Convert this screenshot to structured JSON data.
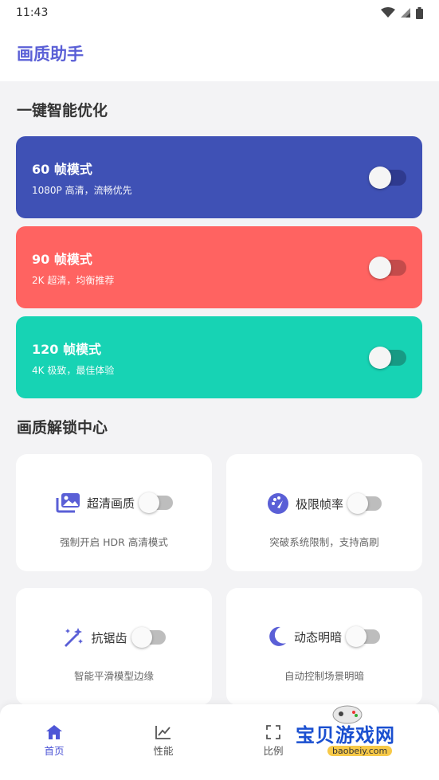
{
  "status": {
    "time": "11:43"
  },
  "header": {
    "title": "画质助手"
  },
  "sections": {
    "one_click": "一键智能优化",
    "unlock_center": "画质解锁中心"
  },
  "modes": [
    {
      "title": "60 帧模式",
      "subtitle": "1080P 高清，流畅优先",
      "color": "#3f51b5"
    },
    {
      "title": "90 帧模式",
      "subtitle": "2K 超清，均衡推荐",
      "color": "#ff6361"
    },
    {
      "title": "120 帧模式",
      "subtitle": "4K 极致，最佳体验",
      "color": "#17d3b4"
    }
  ],
  "features": [
    {
      "label": "超清画质",
      "desc": "强制开启 HDR 高清模式",
      "icon": "images-icon"
    },
    {
      "label": "极限帧率",
      "desc": "突破系统限制，支持高刷",
      "icon": "gauge-icon"
    },
    {
      "label": "抗锯齿",
      "desc": "智能平滑模型边缘",
      "icon": "magic-wand-icon"
    },
    {
      "label": "动态明暗",
      "desc": "自动控制场景明暗",
      "icon": "moon-icon"
    }
  ],
  "nav": [
    {
      "label": "首页",
      "icon": "home-icon",
      "active": true
    },
    {
      "label": "性能",
      "icon": "chart-icon",
      "active": false
    },
    {
      "label": "比例",
      "icon": "fullscreen-icon",
      "active": false
    },
    {
      "label": "",
      "icon": "more-icon",
      "active": false
    }
  ],
  "watermark": {
    "main": "宝贝游戏网",
    "sub": "baobeiy.com"
  },
  "colors": {
    "accent": "#5a5fd6"
  }
}
